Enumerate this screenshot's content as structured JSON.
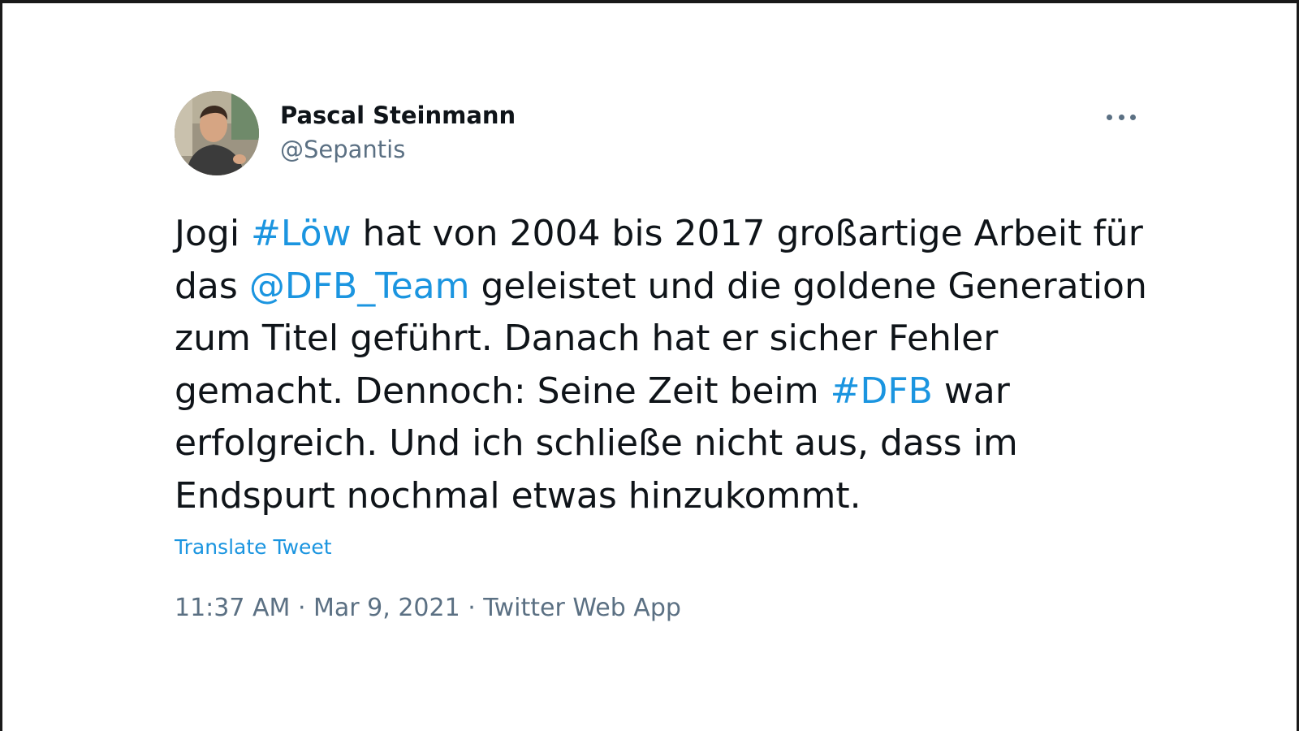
{
  "author": {
    "display_name": "Pascal Steinmann",
    "handle": "@Sepantis"
  },
  "more_icon": "more-horizontal-icon",
  "tweet": {
    "segments": [
      {
        "text": "Jogi ",
        "link": false
      },
      {
        "text": "#Löw",
        "link": true
      },
      {
        "text": " hat von 2004 bis 2017 großartige Arbeit für das ",
        "link": false
      },
      {
        "text": "@DFB_Team",
        "link": true
      },
      {
        "text": " geleistet und die goldene Generation zum Titel geführt. Danach hat er sicher Fehler gemacht. Dennoch: Seine Zeit beim ",
        "link": false
      },
      {
        "text": "#DFB",
        "link": true
      },
      {
        "text": " war erfolgreich. Und ich schließe nicht aus, dass im Endspurt nochmal etwas hinzukommt.",
        "link": false
      }
    ],
    "translate_label": "Translate Tweet"
  },
  "meta": {
    "time": "11:37 AM",
    "date": "Mar 9, 2021",
    "source": "Twitter Web App",
    "separator": " · "
  },
  "colors": {
    "link": "#1b95e0",
    "text": "#0f1419",
    "secondary": "#5b7083"
  }
}
